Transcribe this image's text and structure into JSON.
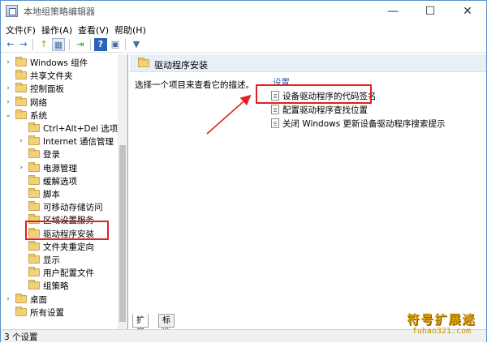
{
  "window": {
    "title": "本地组策略编辑器"
  },
  "window_controls": {
    "minimize": "—",
    "maximize": "☐",
    "close": "✕"
  },
  "menu": {
    "file": "文件(F)",
    "action": "操作(A)",
    "view": "查看(V)",
    "help": "帮助(H)"
  },
  "toolbar": {
    "back": "←",
    "forward": "→",
    "up": "↑",
    "show_tree": "▦",
    "export": "⇥",
    "help": "?",
    "properties": "▣",
    "filter": "▼"
  },
  "tree": [
    {
      "label": "Windows 组件",
      "twisty": "›"
    },
    {
      "label": "共享文件夹",
      "twisty": ""
    },
    {
      "label": "控制面板",
      "twisty": "›"
    },
    {
      "label": "网络",
      "twisty": "›"
    },
    {
      "label": "系统",
      "twisty": "⌄"
    },
    {
      "label": "Ctrl+Alt+Del 选项",
      "twisty": ""
    },
    {
      "label": "Internet 通信管理",
      "twisty": "›"
    },
    {
      "label": "登录",
      "twisty": ""
    },
    {
      "label": "电源管理",
      "twisty": "›"
    },
    {
      "label": "缓解选项",
      "twisty": ""
    },
    {
      "label": "脚本",
      "twisty": ""
    },
    {
      "label": "可移动存储访问",
      "twisty": ""
    },
    {
      "label": "区域设置服务",
      "twisty": ""
    },
    {
      "label": "驱动程序安装",
      "twisty": ""
    },
    {
      "label": "文件夹重定向",
      "twisty": ""
    },
    {
      "label": "显示",
      "twisty": ""
    },
    {
      "label": "用户配置文件",
      "twisty": ""
    },
    {
      "label": "组策略",
      "twisty": ""
    },
    {
      "label": "桌面",
      "twisty": "›"
    },
    {
      "label": "所有设置",
      "twisty": ""
    }
  ],
  "right": {
    "header": "驱动程序安装",
    "description": "选择一个项目来查看它的描述。",
    "column_header": "设置",
    "settings": [
      "设备驱动程序的代码签名",
      "配置驱动程序查找位置",
      "关闭 Windows 更新设备驱动程序搜索提示"
    ]
  },
  "tabs": {
    "extended": "扩展",
    "standard": "标准"
  },
  "status": {
    "text": "3 个设置"
  },
  "watermark": {
    "main": "符号扩展迷",
    "sub": "fuhao321.com"
  }
}
